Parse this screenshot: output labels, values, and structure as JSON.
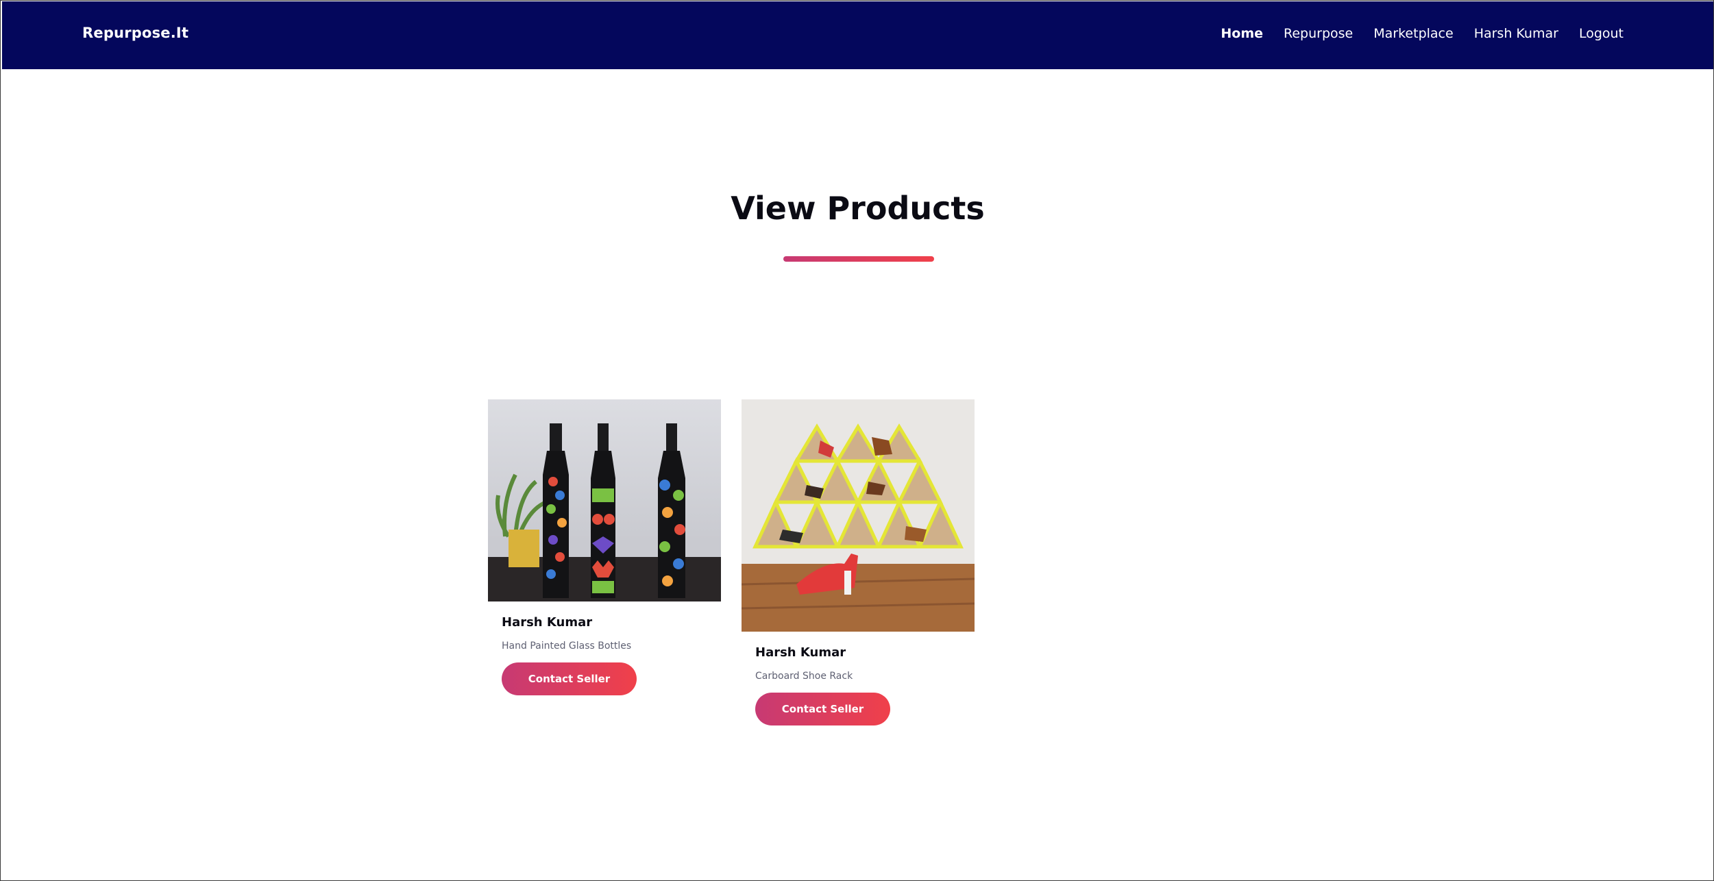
{
  "navbar": {
    "brand": "Repurpose.It",
    "links": [
      {
        "label": "Home",
        "active": true
      },
      {
        "label": "Repurpose",
        "active": false
      },
      {
        "label": "Marketplace",
        "active": false
      },
      {
        "label": "Harsh Kumar",
        "active": false
      },
      {
        "label": "Logout",
        "active": false
      }
    ]
  },
  "main": {
    "title": "View Products",
    "products": [
      {
        "seller": "Harsh Kumar",
        "name": "Hand Painted Glass Bottles",
        "button_label": "Contact Seller",
        "image": "painted-bottles-image"
      },
      {
        "seller": "Harsh Kumar",
        "name": "Carboard Shoe Rack",
        "button_label": "Contact Seller",
        "image": "shoe-rack-image"
      }
    ]
  },
  "colors": {
    "navbar": "#04075c",
    "accent_start": "#c73a73",
    "accent_end": "#f0404a"
  }
}
